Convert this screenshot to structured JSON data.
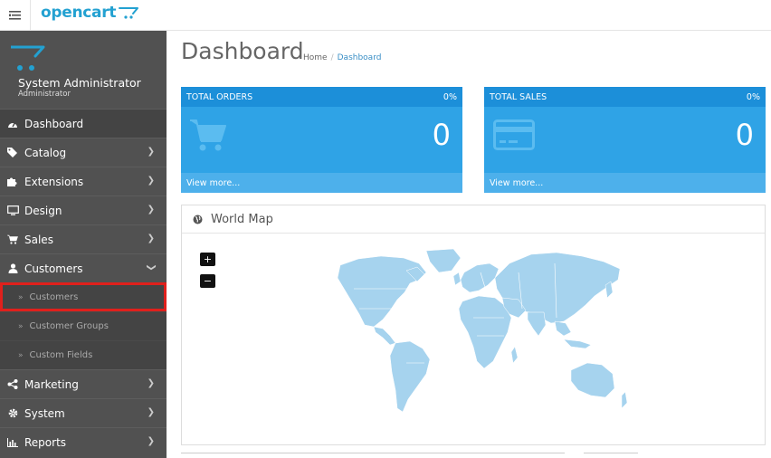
{
  "header": {
    "brand": "opencart",
    "menu_icon": "menu-toggle-icon"
  },
  "profile": {
    "name": "System Administrator",
    "role": "Administrator"
  },
  "sidebar": {
    "items": [
      {
        "label": "Dashboard",
        "icon": "dashboard-icon"
      },
      {
        "label": "Catalog",
        "icon": "tag-icon"
      },
      {
        "label": "Extensions",
        "icon": "puzzle-icon"
      },
      {
        "label": "Design",
        "icon": "monitor-icon"
      },
      {
        "label": "Sales",
        "icon": "cart-icon"
      },
      {
        "label": "Customers",
        "icon": "user-icon"
      },
      {
        "label": "Marketing",
        "icon": "share-icon"
      },
      {
        "label": "System",
        "icon": "gear-icon"
      },
      {
        "label": "Reports",
        "icon": "bar-chart-icon"
      }
    ],
    "customers_sub": [
      {
        "label": "Customers"
      },
      {
        "label": "Customer Groups"
      },
      {
        "label": "Custom Fields"
      }
    ]
  },
  "page": {
    "title": "Dashboard",
    "breadcrumb_home": "Home",
    "breadcrumb_sep": "/",
    "breadcrumb_current": "Dashboard"
  },
  "tiles": [
    {
      "title": "TOTAL ORDERS",
      "percent": "0%",
      "value": "0",
      "footer": "View more..."
    },
    {
      "title": "TOTAL SALES",
      "percent": "0%",
      "value": "0",
      "footer": "View more..."
    }
  ],
  "map": {
    "title": "World Map",
    "zoom_in": "+",
    "zoom_out": "−"
  },
  "colors": {
    "accent": "#23a1d1",
    "tile": "#2fa3e6",
    "sidebar": "#515151",
    "highlight": "#e0201c"
  }
}
